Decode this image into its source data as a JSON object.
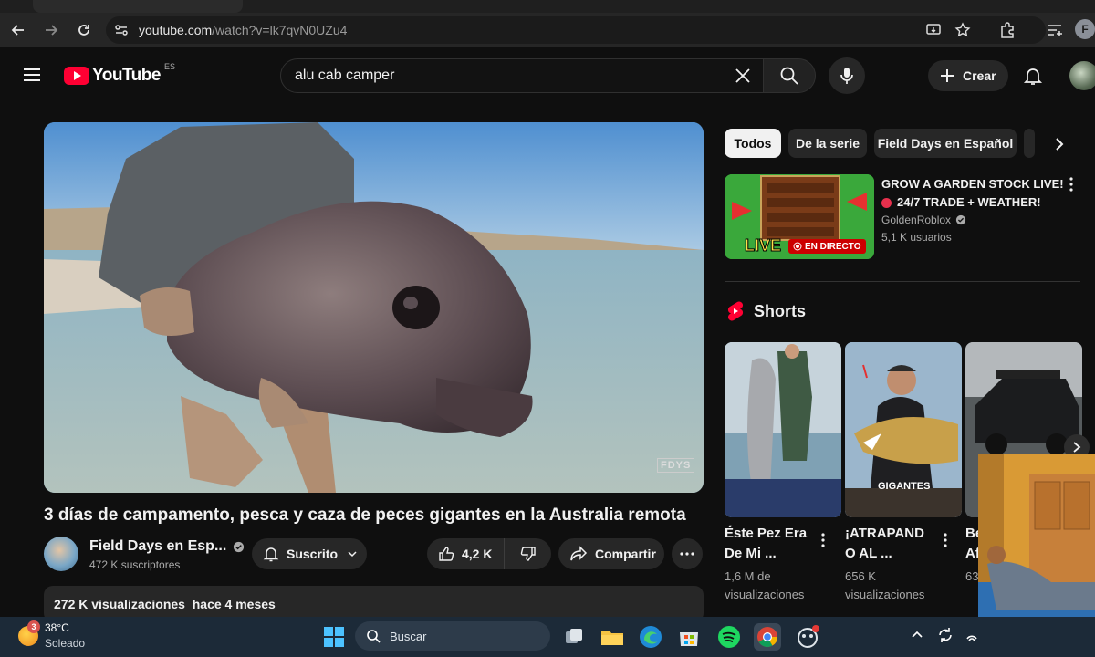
{
  "browser": {
    "url_host": "youtube.com",
    "url_path": "/watch?v=lk7qvN0UZu4",
    "profile_initial": "F"
  },
  "header": {
    "logo_text": "YouTube",
    "region": "ES",
    "search_value": "alu cab camper",
    "create_label": "Crear"
  },
  "video": {
    "watermark": "FDYS",
    "title": "3 días de campamento, pesca y caza de peces gigantes en la Australia remota",
    "channel_name": "Field Days en Esp...",
    "subscribers": "472 K suscriptores",
    "subscribe_label": "Suscrito",
    "likes": "4,2 K",
    "share_label": "Compartir",
    "views": "272 K visualizaciones",
    "age": "hace 4 meses"
  },
  "sidebar": {
    "chips": [
      {
        "label": "Todos",
        "active": true
      },
      {
        "label": "De la serie",
        "active": false
      },
      {
        "label": "Field Days en Español",
        "active": false
      }
    ],
    "live_card": {
      "title_line1": "GROW A GARDEN STOCK LIVE!",
      "title_line2": "24/7 TRADE + WEATHER!",
      "channel": "GoldenRoblox",
      "viewers": "5,1 K usuarios",
      "thumb_text": "LIVE",
      "badge": "EN DIRECTO"
    },
    "shorts_heading": "Shorts",
    "shorts": [
      {
        "title_line1": "Éste Pez Era",
        "title_line2": "De Mi ...",
        "views_line1": "1,6 M de",
        "views_line2": "visualizaciones",
        "overlay": ""
      },
      {
        "title_line1": "¡ATRAPAND",
        "title_line2": "O AL ...",
        "views_line1": "656 K",
        "views_line2": "visualizaciones",
        "overlay": "GIGANTES"
      },
      {
        "title_line1": "Be",
        "title_line2": "Af",
        "views_line1": "63",
        "views_line2": "",
        "overlay": ""
      }
    ]
  },
  "taskbar": {
    "weather_temp": "38°C",
    "weather_desc": "Soleado",
    "weather_badge": "3",
    "search_label": "Buscar"
  },
  "colors": {
    "accent_red": "#ff0033",
    "background": "#0f0f0f",
    "chip_bg": "#272727"
  }
}
